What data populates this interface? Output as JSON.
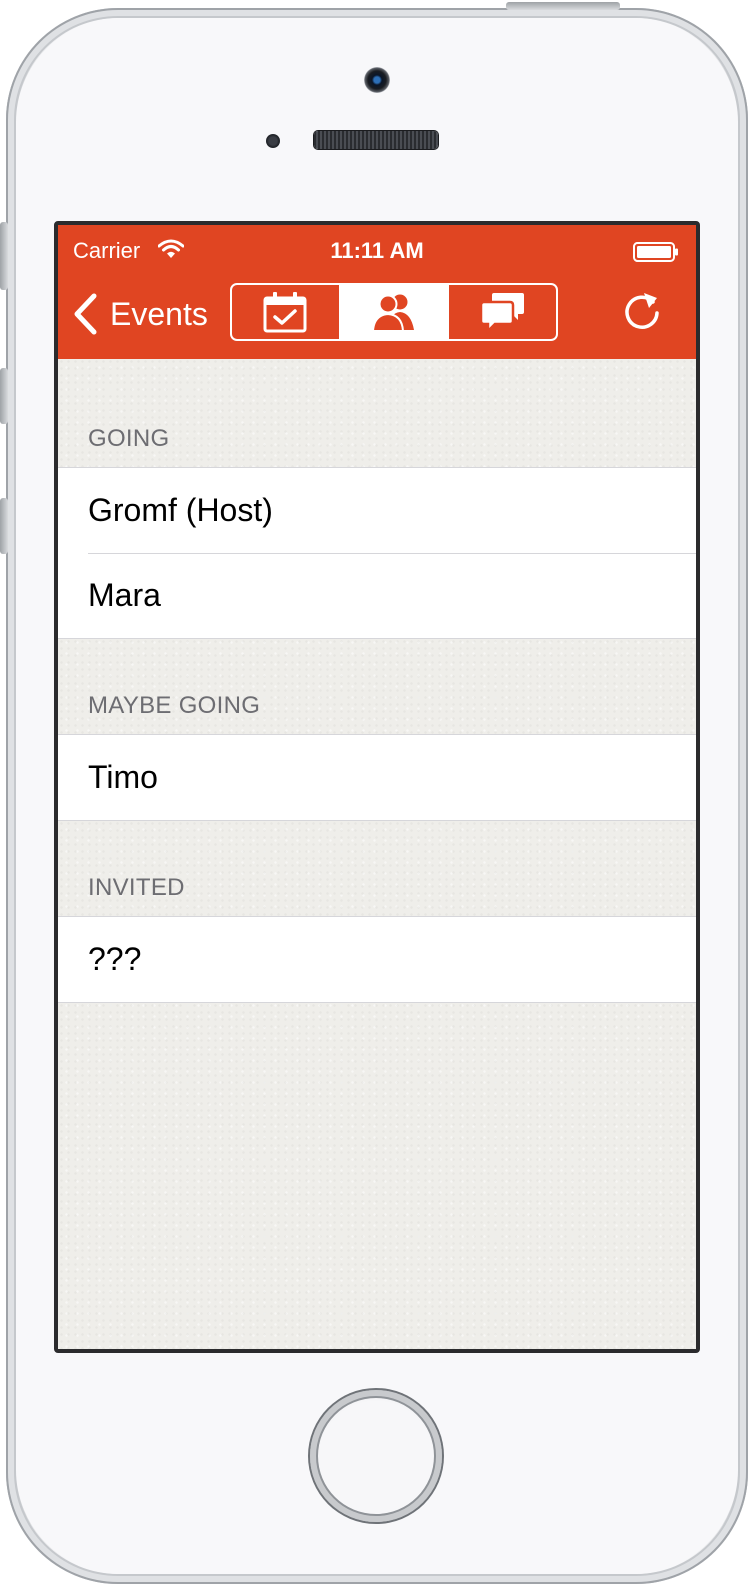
{
  "status_bar": {
    "carrier": "Carrier",
    "time": "11:11 AM"
  },
  "nav": {
    "back_label": "Events",
    "segments": [
      "calendar-check-icon",
      "people-icon",
      "chat-bubbles-icon"
    ],
    "selected_segment": "people-icon",
    "accent_color": "#e04522"
  },
  "sections": [
    {
      "header": "GOING",
      "rows": [
        "Gromf (Host)",
        "Mara"
      ]
    },
    {
      "header": "MAYBE GOING",
      "rows": [
        "Timo"
      ]
    },
    {
      "header": "INVITED",
      "rows": [
        "???"
      ]
    }
  ]
}
